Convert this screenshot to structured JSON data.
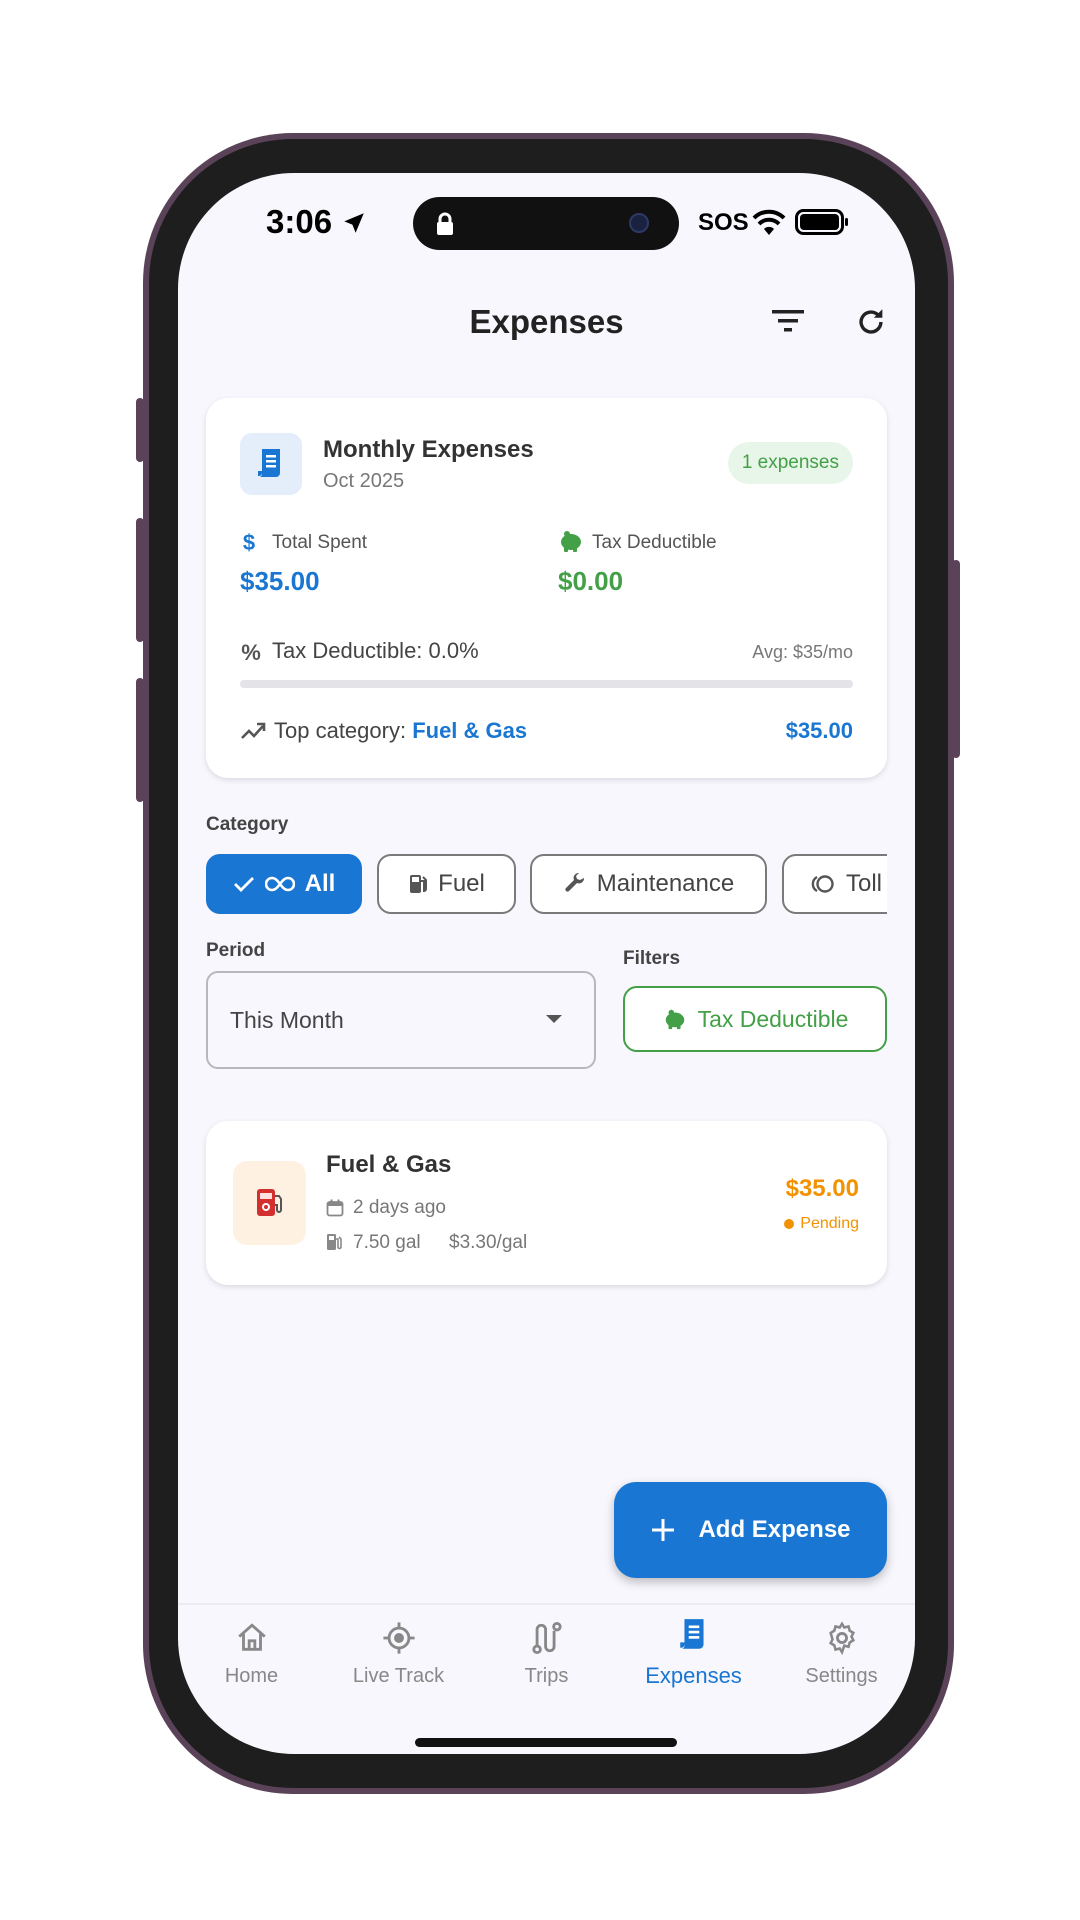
{
  "status_bar": {
    "time": "3:06",
    "carrier": "SOS"
  },
  "header": {
    "title": "Expenses"
  },
  "summary": {
    "title": "Monthly Expenses",
    "period": "Oct 2025",
    "badge": "1 expenses",
    "total_spent_label": "Total Spent",
    "total_spent_value": "$35.00",
    "tax_deductible_label": "Tax Deductible",
    "tax_deductible_value": "$0.00",
    "tax_percent_text": "Tax Deductible: 0.0%",
    "tax_percent_fraction": 0.0,
    "avg_text": "Avg: $35/mo",
    "top_category_label": "Top category: ",
    "top_category_name": "Fuel & Gas",
    "top_category_value": "$35.00"
  },
  "category": {
    "label": "Category",
    "chips": [
      {
        "label": "All",
        "selected": true
      },
      {
        "label": "Fuel",
        "selected": false
      },
      {
        "label": "Maintenance",
        "selected": false
      },
      {
        "label": "Toll",
        "selected": false
      }
    ]
  },
  "period": {
    "label": "Period",
    "value": "This Month"
  },
  "filters": {
    "label": "Filters",
    "tax_deductible_label": "Tax Deductible"
  },
  "expense_item": {
    "title": "Fuel & Gas",
    "date": "2 days ago",
    "gallons": "7.50 gal",
    "price_per_gal": "$3.30/gal",
    "amount": "$35.00",
    "status": "Pending"
  },
  "fab": {
    "label": "Add Expense"
  },
  "bottom_nav": [
    {
      "label": "Home",
      "icon": "home-icon",
      "active": false
    },
    {
      "label": "Live Track",
      "icon": "gps-icon",
      "active": false
    },
    {
      "label": "Trips",
      "icon": "route-icon",
      "active": false
    },
    {
      "label": "Expenses",
      "icon": "receipt-icon",
      "active": true
    },
    {
      "label": "Settings",
      "icon": "gear-icon",
      "active": false
    }
  ],
  "colors": {
    "primary": "#1976d2",
    "green": "#43a047",
    "orange": "#f39200",
    "background": "#f7f7fd"
  }
}
